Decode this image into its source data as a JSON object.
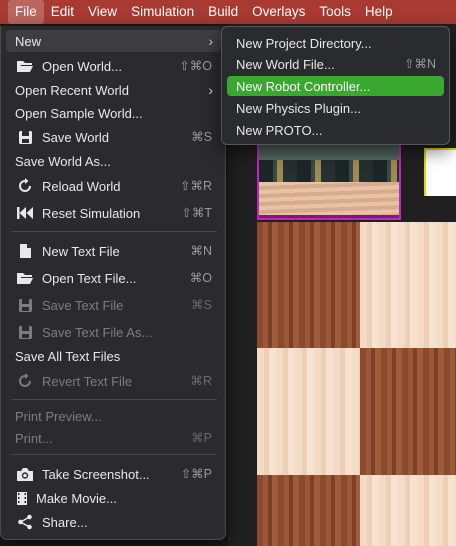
{
  "menubar": {
    "items": [
      {
        "label": "File",
        "active": true
      },
      {
        "label": "Edit",
        "active": false
      },
      {
        "label": "View",
        "active": false
      },
      {
        "label": "Simulation",
        "active": false
      },
      {
        "label": "Build",
        "active": false
      },
      {
        "label": "Overlays",
        "active": false
      },
      {
        "label": "Tools",
        "active": false
      },
      {
        "label": "Help",
        "active": false
      }
    ]
  },
  "file_menu": {
    "items": [
      {
        "label": "New",
        "submenu": true,
        "selected": true
      },
      {
        "label": "Open World...",
        "icon": "folder-open-icon",
        "shortcut": "⇧⌘O"
      },
      {
        "label": "Open Recent World",
        "submenu": true
      },
      {
        "label": "Open Sample World..."
      },
      {
        "label": "Save World",
        "icon": "floppy-disk-icon",
        "shortcut": "⌘S"
      },
      {
        "label": "Save World As..."
      },
      {
        "label": "Reload World",
        "icon": "reload-icon",
        "shortcut": "⇧⌘R"
      },
      {
        "label": "Reset Simulation",
        "icon": "rewind-icon",
        "shortcut": "⇧⌘T"
      },
      {
        "label": "New Text File",
        "icon": "new-file-icon",
        "shortcut": "⌘N"
      },
      {
        "label": "Open Text File...",
        "icon": "folder-open-icon",
        "shortcut": "⌘O"
      },
      {
        "label": "Save Text File",
        "icon": "floppy-disk-icon",
        "shortcut": "⌘S",
        "disabled": true
      },
      {
        "label": "Save Text File As...",
        "icon": "floppy-disk-icon",
        "disabled": true
      },
      {
        "label": "Save All Text Files"
      },
      {
        "label": "Revert Text File",
        "icon": "reload-icon",
        "shortcut": "⌘R",
        "disabled": true
      },
      {
        "label": "Print Preview...",
        "disabled": true
      },
      {
        "label": "Print...",
        "shortcut": "⌘P",
        "disabled": true
      },
      {
        "label": "Take Screenshot...",
        "icon": "camera-icon",
        "shortcut": "⇧⌘P"
      },
      {
        "label": "Make Movie...",
        "icon": "film-icon"
      },
      {
        "label": "Share...",
        "icon": "share-icon"
      }
    ]
  },
  "new_submenu": {
    "items": [
      {
        "label": "New Project Directory..."
      },
      {
        "label": "New World File...",
        "shortcut": "⇧⌘N"
      },
      {
        "label": "New Robot Controller...",
        "highlighted": true
      },
      {
        "label": "New Physics Plugin..."
      },
      {
        "label": "New PROTO..."
      }
    ]
  },
  "colors": {
    "menubar": "#a83a32",
    "menu_background": "#2b2b2e",
    "highlight": "#39a82e",
    "disabled_text": "#7d7d80"
  }
}
